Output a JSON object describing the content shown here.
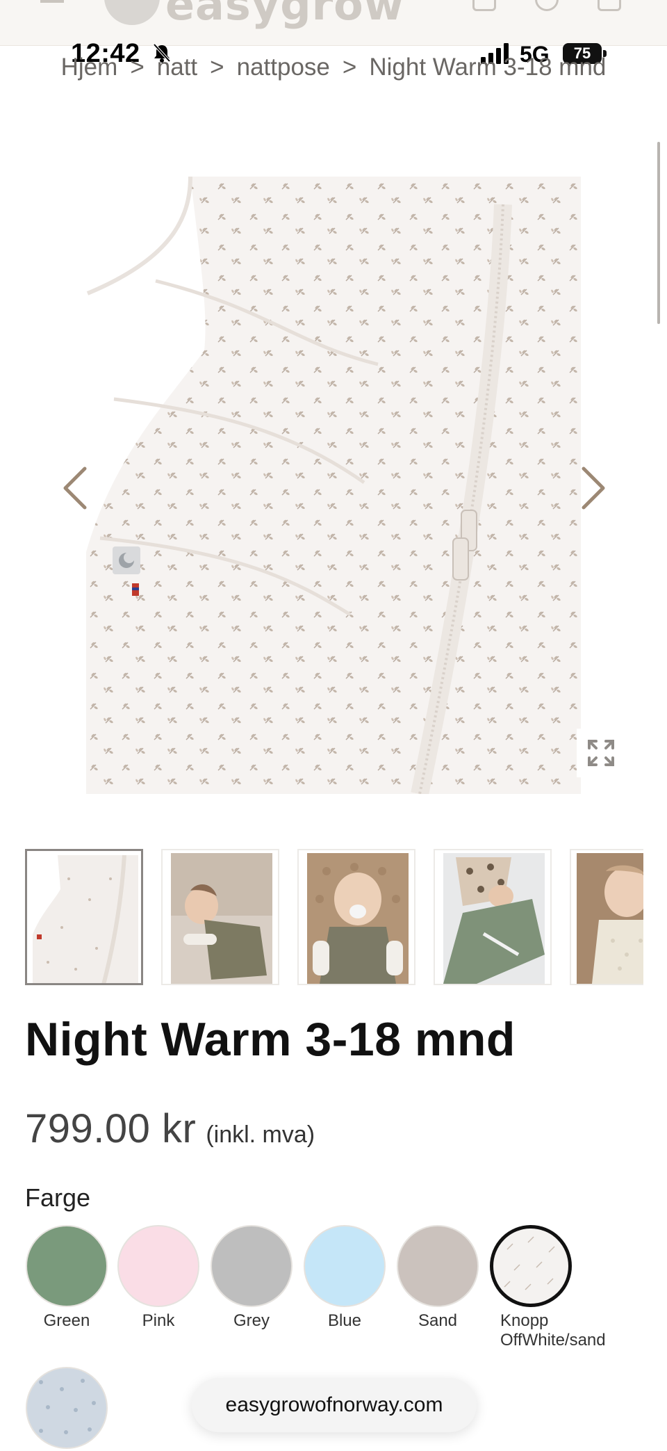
{
  "header": {
    "logo_text": "easygrow"
  },
  "status_bar": {
    "time": "12:42",
    "network": "5G",
    "battery": "75"
  },
  "breadcrumb": {
    "items": [
      "Hjem",
      "natt",
      "nattpose",
      "Night Warm 3-18 mnd"
    ],
    "separator": ">"
  },
  "gallery": {
    "main_image": "sleeping-bag-floral-print",
    "prev_icon": "chevron-left-icon",
    "next_icon": "chevron-right-icon",
    "expand_icon": "expand-icon",
    "thumbnails": [
      {
        "subject": "sleeping-bag-floral",
        "active": true
      },
      {
        "subject": "baby-sleeping-green-bag",
        "active": false
      },
      {
        "subject": "baby-sitting-pacifier",
        "active": false
      },
      {
        "subject": "baby-lying-green-bag",
        "active": false
      },
      {
        "subject": "baby-knit-vest",
        "active": false
      }
    ]
  },
  "product": {
    "title": "Night Warm 3-18 mnd",
    "price": "799.00 kr",
    "vat_note": "(inkl. mva)",
    "color_label": "Farge",
    "colors": [
      {
        "name": "Green",
        "hex": "#7a9a7c",
        "selected": false
      },
      {
        "name": "Pink",
        "hex": "#fadde6",
        "selected": false
      },
      {
        "name": "Grey",
        "hex": "#bebebe",
        "selected": false
      },
      {
        "name": "Blue",
        "hex": "#c5e6f8",
        "selected": false
      },
      {
        "name": "Sand",
        "hex": "#cbc2bd",
        "selected": false
      },
      {
        "name": "Knopp OffWhite/sand",
        "hex": "#f4f2f0",
        "selected": true
      },
      {
        "name": "",
        "hex": "#cfd8e2",
        "selected": false
      }
    ]
  },
  "browser": {
    "url": "easygrowofnorway.com"
  }
}
